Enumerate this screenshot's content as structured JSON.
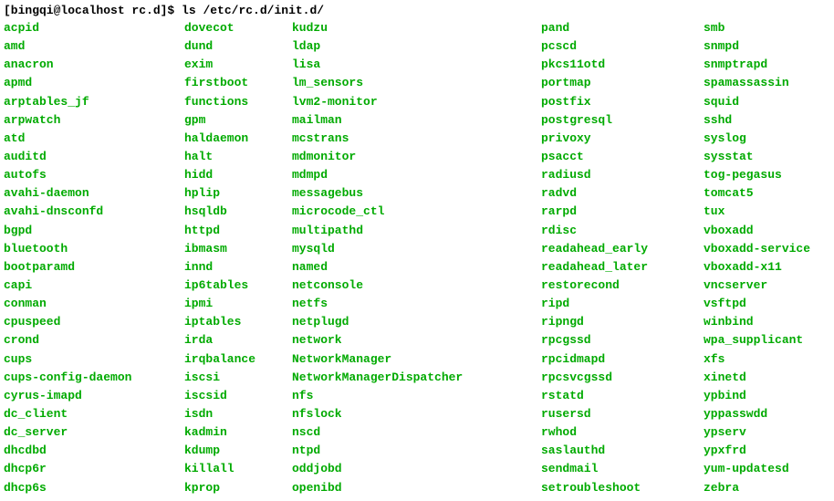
{
  "prompt": "[bingqi@localhost rc.d]$ ",
  "command": "ls /etc/rc.d/init.d/",
  "columns": [
    [
      "acpid",
      "amd",
      "anacron",
      "apmd",
      "arptables_jf",
      "arpwatch",
      "atd",
      "auditd",
      "autofs",
      "avahi-daemon",
      "avahi-dnsconfd",
      "bgpd",
      "bluetooth",
      "bootparamd",
      "capi",
      "conman",
      "cpuspeed",
      "crond",
      "cups",
      "cups-config-daemon",
      "cyrus-imapd",
      "dc_client",
      "dc_server",
      "dhcdbd",
      "dhcp6r",
      "dhcp6s"
    ],
    [
      "dovecot",
      "dund",
      "exim",
      "firstboot",
      "functions",
      "gpm",
      "haldaemon",
      "halt",
      "hidd",
      "hplip",
      "hsqldb",
      "httpd",
      "ibmasm",
      "innd",
      "ip6tables",
      "ipmi",
      "iptables",
      "irda",
      "irqbalance",
      "iscsi",
      "iscsid",
      "isdn",
      "kadmin",
      "kdump",
      "killall",
      "kprop"
    ],
    [
      "kudzu",
      "ldap",
      "lisa",
      "lm_sensors",
      "lvm2-monitor",
      "mailman",
      "mcstrans",
      "mdmonitor",
      "mdmpd",
      "messagebus",
      "microcode_ctl",
      "multipathd",
      "mysqld",
      "named",
      "netconsole",
      "netfs",
      "netplugd",
      "network",
      "NetworkManager",
      "NetworkManagerDispatcher",
      "nfs",
      "nfslock",
      "nscd",
      "ntpd",
      "oddjobd",
      "openibd"
    ],
    [
      "pand",
      "pcscd",
      "pkcs11otd",
      "portmap",
      "postfix",
      "postgresql",
      "privoxy",
      "psacct",
      "radiusd",
      "radvd",
      "rarpd",
      "rdisc",
      "readahead_early",
      "readahead_later",
      "restorecond",
      "ripd",
      "ripngd",
      "rpcgssd",
      "rpcidmapd",
      "rpcsvcgssd",
      "rstatd",
      "rusersd",
      "rwhod",
      "saslauthd",
      "sendmail",
      "setroubleshoot"
    ],
    [
      "smb",
      "snmpd",
      "snmptrapd",
      "spamassassin",
      "squid",
      "sshd",
      "syslog",
      "sysstat",
      "tog-pegasus",
      "tomcat5",
      "tux",
      "vboxadd",
      "vboxadd-service",
      "vboxadd-x11",
      "vncserver",
      "vsftpd",
      "winbind",
      "wpa_supplicant",
      "xfs",
      "xinetd",
      "ypbind",
      "yppasswdd",
      "ypserv",
      "ypxfrd",
      "yum-updatesd",
      "zebra"
    ]
  ]
}
